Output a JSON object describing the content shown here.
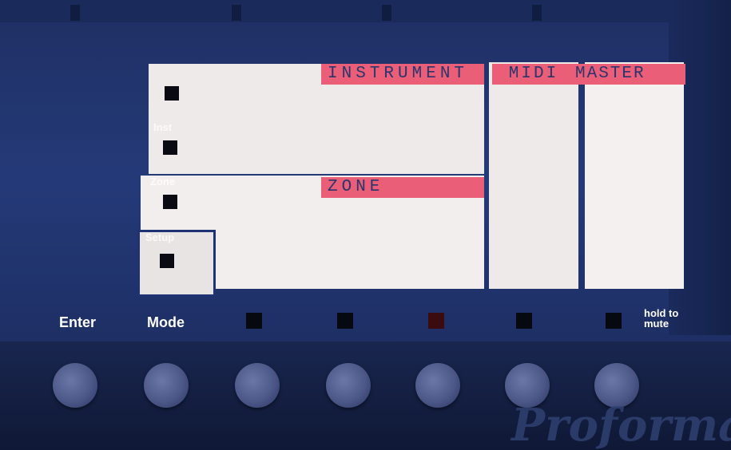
{
  "screen": {
    "section_labels": {
      "instrument": "INSTRUMENT",
      "zone": "ZONE",
      "midi": "MIDI",
      "master": "MASTER"
    },
    "side_labels": {
      "inst": "Inst",
      "zone": "Zone",
      "setup": "Setup"
    }
  },
  "buttons": {
    "enter": "Enter",
    "mode": "Mode",
    "hold_to_mute": "hold to mute"
  },
  "brand": "Proformance",
  "colors": {
    "accent": "#ea5f77",
    "panel": "#efeaea",
    "body": "#243a78"
  }
}
